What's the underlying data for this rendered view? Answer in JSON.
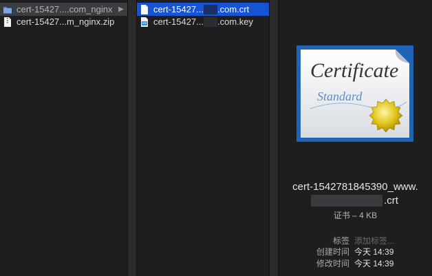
{
  "column1": {
    "folder_label": "cert-15427....com_nginx",
    "zip_label": "cert-15427...m_nginx.zip"
  },
  "column2": {
    "crt_label_prefix": "cert-15427",
    "crt_label_suffix": ".com.crt",
    "key_label_prefix": "cert-15427",
    "key_label_suffix": ".com.key",
    "crt_dots": "...",
    "key_dots": "..."
  },
  "preview": {
    "icon_title": "Certificate",
    "icon_subtitle": "Standard",
    "filename_line1": "cert-1542781845390_www.",
    "filename_line2": ".crt",
    "kind": "证书 – 4 KB",
    "meta": [
      {
        "label": "标签",
        "value": "添加标签...",
        "placeholder": true
      },
      {
        "label": "创建时间",
        "value": "今天 14:39",
        "placeholder": false
      },
      {
        "label": "修改时间",
        "value": "今天 14:39",
        "placeholder": false
      }
    ]
  },
  "colors": {
    "selection": "#1654d3",
    "background": "#1e1e1e",
    "inactive_selection": "#3a3d41"
  }
}
